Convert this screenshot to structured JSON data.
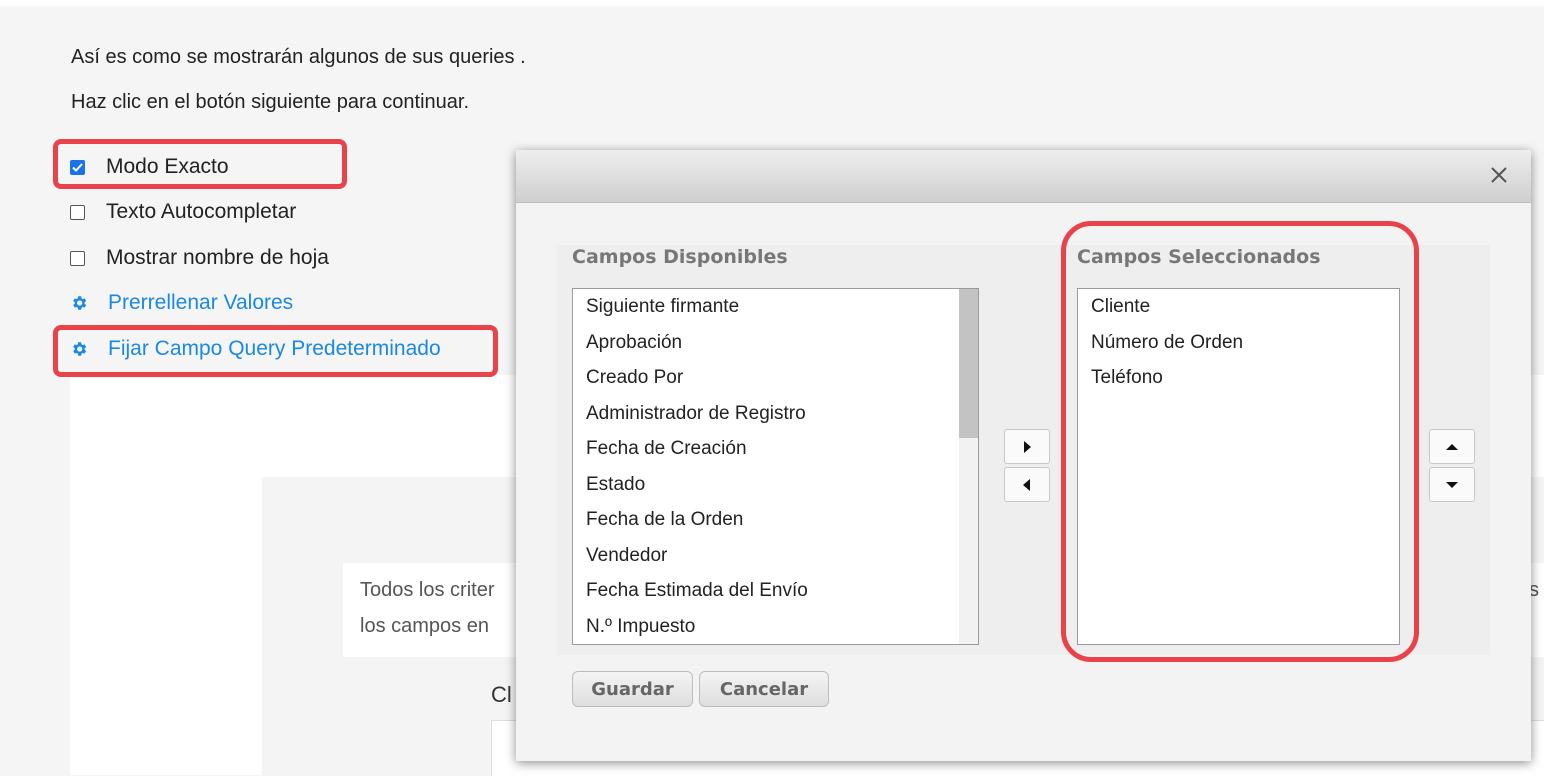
{
  "intro": {
    "line1": "Así es como se mostrarán algunos de sus queries .",
    "line2": "Haz clic en el botón siguiente para continuar."
  },
  "options": {
    "exact_mode": {
      "label": "Modo Exacto",
      "checked": true
    },
    "autocomplete": {
      "label": "Texto Autocompletar",
      "checked": false
    },
    "show_sheet_name": {
      "label": "Mostrar nombre de hoja",
      "checked": false
    },
    "prefill": {
      "label": "Prerrellenar Valores",
      "icon": "gear-icon"
    },
    "default_query_field": {
      "label": "Fijar Campo Query Predeterminado",
      "icon": "gear-icon"
    }
  },
  "background": {
    "criteria_line1": "Todos los criter",
    "criteria_line2": "los campos en",
    "trailing_char": "s",
    "section_label": "Cl"
  },
  "dialog": {
    "close_icon": "close-icon",
    "available": {
      "title": "Campos Disponibles",
      "items": [
        "Siguiente firmante",
        "Aprobación",
        "Creado Por",
        "Administrador de Registro",
        "Fecha de Creación",
        "Estado",
        "Fecha de la Orden",
        "Vendedor",
        "Fecha Estimada del Envío",
        "N.º Impuesto"
      ]
    },
    "selected": {
      "title": "Campos Seleccionados",
      "items": [
        "Cliente",
        "Número de Orden",
        "Teléfono"
      ]
    },
    "buttons": {
      "add": "caret-right-icon",
      "remove": "caret-left-icon",
      "up": "caret-up-icon",
      "down": "caret-down-icon",
      "save": "Guardar",
      "cancel": "Cancelar"
    }
  },
  "colors": {
    "highlight": "#e8434a",
    "link": "#1a88e6",
    "checkbox": "#1a73e8"
  }
}
